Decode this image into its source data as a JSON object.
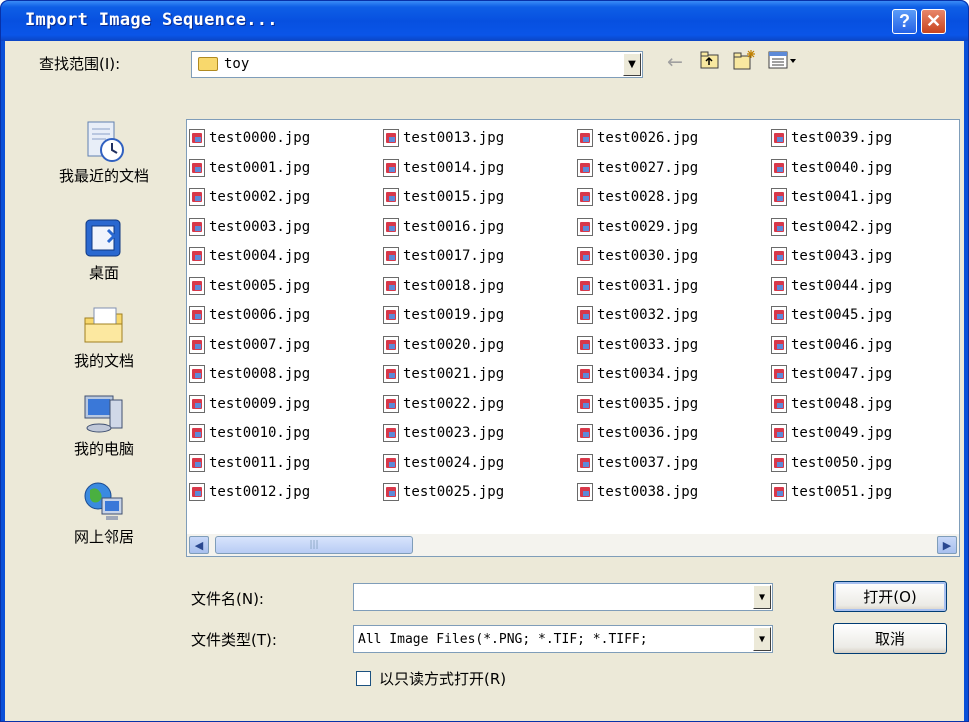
{
  "window": {
    "title": "Import Image Sequence...",
    "help_label": "?",
    "close_label": "✕"
  },
  "lookin": {
    "label": "查找范围(I):",
    "value": "toy"
  },
  "places": [
    {
      "label": "我最近的文档",
      "icon": "recent-documents-icon"
    },
    {
      "label": "桌面",
      "icon": "desktop-icon"
    },
    {
      "label": "我的文档",
      "icon": "my-documents-icon"
    },
    {
      "label": "我的电脑",
      "icon": "my-computer-icon"
    },
    {
      "label": "网上邻居",
      "icon": "network-icon"
    }
  ],
  "files": [
    "test0000.jpg",
    "test0001.jpg",
    "test0002.jpg",
    "test0003.jpg",
    "test0004.jpg",
    "test0005.jpg",
    "test0006.jpg",
    "test0007.jpg",
    "test0008.jpg",
    "test0009.jpg",
    "test0010.jpg",
    "test0011.jpg",
    "test0012.jpg",
    "test0013.jpg",
    "test0014.jpg",
    "test0015.jpg",
    "test0016.jpg",
    "test0017.jpg",
    "test0018.jpg",
    "test0019.jpg",
    "test0020.jpg",
    "test0021.jpg",
    "test0022.jpg",
    "test0023.jpg",
    "test0024.jpg",
    "test0025.jpg",
    "test0026.jpg",
    "test0027.jpg",
    "test0028.jpg",
    "test0029.jpg",
    "test0030.jpg",
    "test0031.jpg",
    "test0032.jpg",
    "test0033.jpg",
    "test0034.jpg",
    "test0035.jpg",
    "test0036.jpg",
    "test0037.jpg",
    "test0038.jpg",
    "test0039.jpg",
    "test0040.jpg",
    "test0041.jpg",
    "test0042.jpg",
    "test0043.jpg",
    "test0044.jpg",
    "test0045.jpg",
    "test0046.jpg",
    "test0047.jpg",
    "test0048.jpg",
    "test0049.jpg",
    "test0050.jpg",
    "test0051.jpg"
  ],
  "filename": {
    "label": "文件名(N):",
    "value": ""
  },
  "filetype": {
    "label": "文件类型(T):",
    "value": "All Image Files(*.PNG; *.TIF; *.TIFF;"
  },
  "readonly": {
    "label": "以只读方式打开(R)",
    "checked": false
  },
  "buttons": {
    "open": "打开(O)",
    "cancel": "取消"
  },
  "scrollbar": {
    "left_arrow": "◀",
    "right_arrow": "▶",
    "grip": "|||"
  },
  "colors": {
    "titlebar": "#0a50d8",
    "dialog_bg": "#ece9d8",
    "border": "#7f9db9"
  }
}
